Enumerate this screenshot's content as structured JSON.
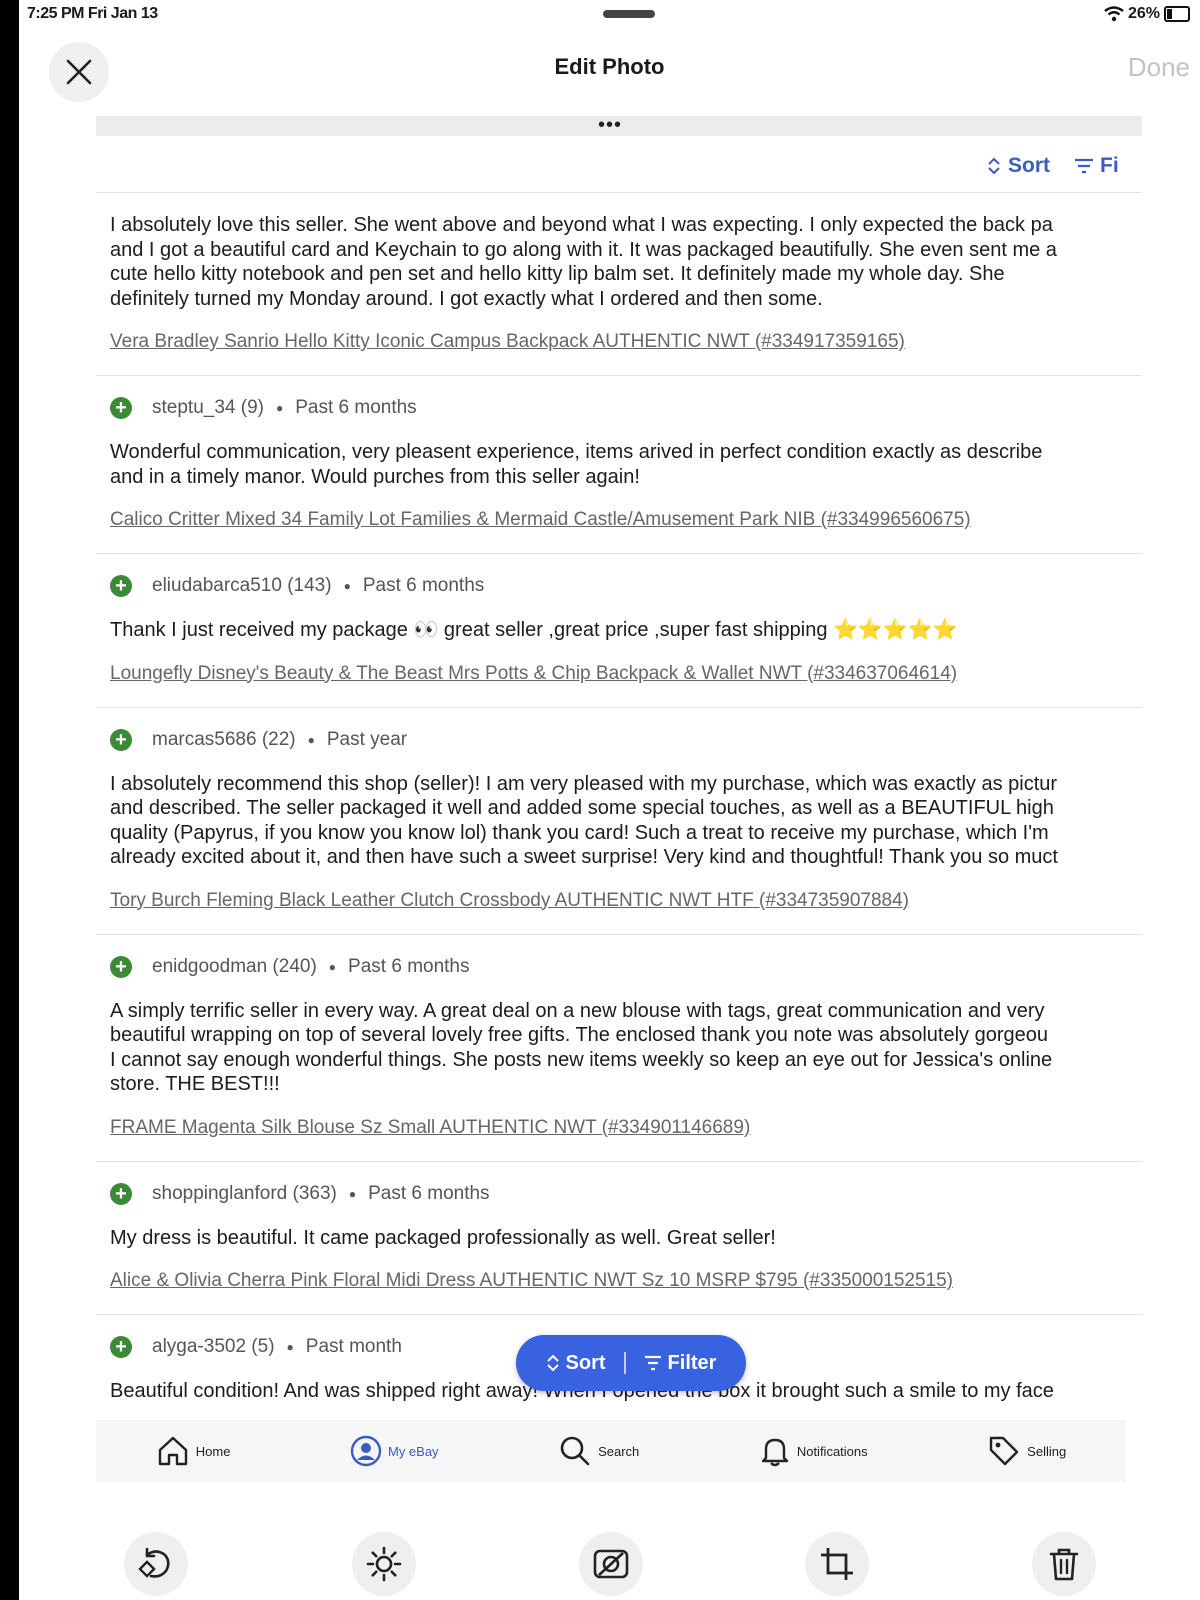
{
  "status_bar": {
    "time": "7:25 PM  Fri Jan 13",
    "battery": "26%"
  },
  "editor": {
    "title": "Edit Photo",
    "done_label": "Done"
  },
  "photo": {
    "sort_label": "Sort",
    "filter_label": "Fi",
    "reviews": [
      {
        "text": [
          "I absolutely love this seller. She went above and beyond what I was expecting. I only expected the back pa",
          "and I got a beautiful card and Keychain to go along with it. It was packaged beautifully. She even sent me a",
          "cute hello kitty notebook and pen set and hello kitty lip balm set. It definitely made my whole day. She",
          "definitely turned my Monday around. I got exactly what I ordered and then some."
        ],
        "item": "Vera Bradley Sanrio Hello Kitty Iconic Campus Backpack AUTHENTIC NWT (#334917359165)"
      },
      {
        "user": "steptu_34 (9)",
        "time": "Past 6 months",
        "text": [
          "Wonderful communication, very pleasent experience, items arived in perfect condition exactly as describe",
          "and in a timely manor. Would purches from this seller again!"
        ],
        "item": "Calico Critter Mixed 34 Family Lot Families & Mermaid Castle/Amusement Park NIB (#334996560675)"
      },
      {
        "user": "eliudabarca510 (143)",
        "time": "Past 6 months",
        "text": [
          "Thank I just received my package 👀 great seller ,great price ,super fast shipping ⭐⭐⭐⭐⭐"
        ],
        "item": "Loungefly Disney's Beauty & The Beast Mrs Potts & Chip Backpack & Wallet NWT (#334637064614)"
      },
      {
        "user": "marcas5686 (22)",
        "time": "Past year",
        "text": [
          "I absolutely recommend this shop (seller)! I am very pleased with my purchase, which was exactly as pictur",
          "and described. The seller packaged it well and added some special touches, as well as a BEAUTIFUL high",
          "quality (Papyrus, if you know you know lol) thank you card! Such a treat to receive my purchase, which I'm",
          "already excited about it, and then have such a sweet surprise! Very kind and thoughtful! Thank you so muct"
        ],
        "item": "Tory Burch Fleming Black Leather Clutch Crossbody AUTHENTIC NWT HTF (#334735907884)"
      },
      {
        "user": "enidgoodman (240)",
        "time": "Past 6 months",
        "text": [
          "A simply terrific seller in every way. A great deal on a new blouse with tags, great communication and very",
          "beautiful wrapping on top of several lovely free gifts. The enclosed thank you note was absolutely gorgeou",
          "I cannot say enough wonderful things. She posts new items weekly so keep an eye out for Jessica's online",
          "store. THE BEST!!!"
        ],
        "item": "FRAME Magenta Silk Blouse Sz Small AUTHENTIC NWT (#334901146689)"
      },
      {
        "user": "shoppinglanford (363)",
        "time": "Past 6 months",
        "text": [
          "My dress is beautiful. It came packaged professionally as well. Great seller!"
        ],
        "item": "Alice & Olivia Cherra Pink Floral Midi Dress AUTHENTIC NWT Sz 10 MSRP $795 (#335000152515)"
      },
      {
        "user": "alyga-3502 (5)",
        "time": "Past month",
        "text": [
          "Beautiful condition! And was shipped right away! When I opened the box it brought such a smile to my face"
        ]
      }
    ],
    "float_sort": "Sort",
    "float_filter": "Filter",
    "nav": {
      "home": "Home",
      "myebay": "My eBay",
      "search": "Search",
      "notifications": "Notifications",
      "selling": "Selling"
    }
  },
  "colors": {
    "accent": "#3862e0",
    "positive": "#3a8a36"
  },
  "toolbar_icons": [
    "rotate-icon",
    "adjust-brightness-icon",
    "filters-icon",
    "crop-icon",
    "delete-icon"
  ]
}
